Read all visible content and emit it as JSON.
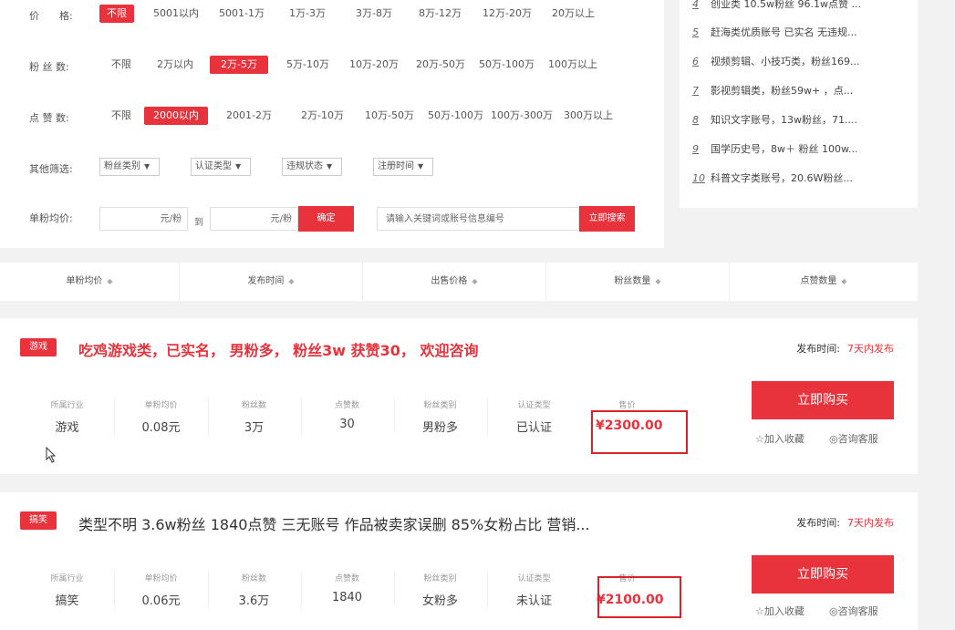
{
  "filters": {
    "price": {
      "label": "价　　格:",
      "options": [
        "不限",
        "5001以内",
        "5001-1万",
        "1万-3万",
        "3万-8万",
        "8万-12万",
        "12万-20万",
        "20万以上"
      ],
      "active": 0
    },
    "fans": {
      "label": "粉 丝 数:",
      "options": [
        "不限",
        "2万以内",
        "2万-5万",
        "5万-10万",
        "10万-20万",
        "20万-50万",
        "50万-100万",
        "100万以上"
      ],
      "active": 2
    },
    "likes": {
      "label": "点 赞 数:",
      "options": [
        "不限",
        "2000以内",
        "2001-2万",
        "2万-10万",
        "10万-50万",
        "50万-100万",
        "100万-300万",
        "300万以上"
      ],
      "active": 1
    },
    "other": {
      "label": "其他筛选:",
      "selects": [
        "粉丝类别",
        "认证类型",
        "违规状态",
        "注册时间"
      ]
    },
    "unit_price": {
      "label": "单粉均价:",
      "from_unit": "元/粉",
      "to_label": "到",
      "to_unit": "元/粉",
      "confirm": "确定",
      "search_placeholder": "请输入关键词或账号信息编号",
      "search_button": "立即搜索"
    }
  },
  "side_list": [
    {
      "num": "4",
      "text": "创业类 10.5w粉丝 96.1w点赞 ..."
    },
    {
      "num": "5",
      "text": "赶海类优质账号 已实名 无违规..."
    },
    {
      "num": "6",
      "text": "视频剪辑、小技巧类，粉丝169..."
    },
    {
      "num": "7",
      "text": "影视剪辑类，粉丝59w+ ，点..."
    },
    {
      "num": "8",
      "text": "知识文字账号，13w粉丝，71...."
    },
    {
      "num": "9",
      "text": "国学历史号，8w＋ 粉丝 100w..."
    },
    {
      "num": "10",
      "text": "科普文字类账号，20.6W粉丝..."
    }
  ],
  "sort_bar": [
    "单粉均价",
    "发布时间",
    "出售价格",
    "粉丝数量",
    "点赞数量"
  ],
  "listings": [
    {
      "tag": "游戏",
      "title": "吃鸡游戏类，已实名， 男粉多， 粉丝3w 获赞30， 欢迎咨询",
      "pub_label": "发布时间:",
      "pub_value": "7天内发布",
      "headers": [
        "所属行业",
        "单粉均价",
        "粉丝数",
        "点赞数",
        "粉丝类别",
        "认证类型",
        "售价"
      ],
      "values": [
        "游戏",
        "0.08元",
        "3万",
        "30",
        "男粉多",
        "已认证"
      ],
      "price": "¥2300.00",
      "buy": "立即购买",
      "fav": "加入收藏",
      "consult": "咨询客服"
    },
    {
      "tag": "搞笑",
      "title": "类型不明 3.6w粉丝 1840点赞 三无账号 作品被卖家误删 85%女粉占比 营销...",
      "pub_label": "发布时间:",
      "pub_value": "7天内发布",
      "headers": [
        "所属行业",
        "单粉均价",
        "粉丝数",
        "点赞数",
        "粉丝类别",
        "认证类型",
        "售价"
      ],
      "values": [
        "搞笑",
        "0.06元",
        "3.6万",
        "1840",
        "女粉多",
        "未认证"
      ],
      "price": "¥2100.00",
      "buy": "立即购买",
      "fav": "加入收藏",
      "consult": "咨询客服"
    }
  ],
  "icons": {
    "caret": "caret-down-icon",
    "sort": "sort-arrows-icon",
    "star": "star-icon",
    "chat": "chat-icon",
    "cursor": "mouse-cursor-icon"
  },
  "colors": {
    "accent": "#e8323c",
    "highlight_box": "#d9232b"
  }
}
